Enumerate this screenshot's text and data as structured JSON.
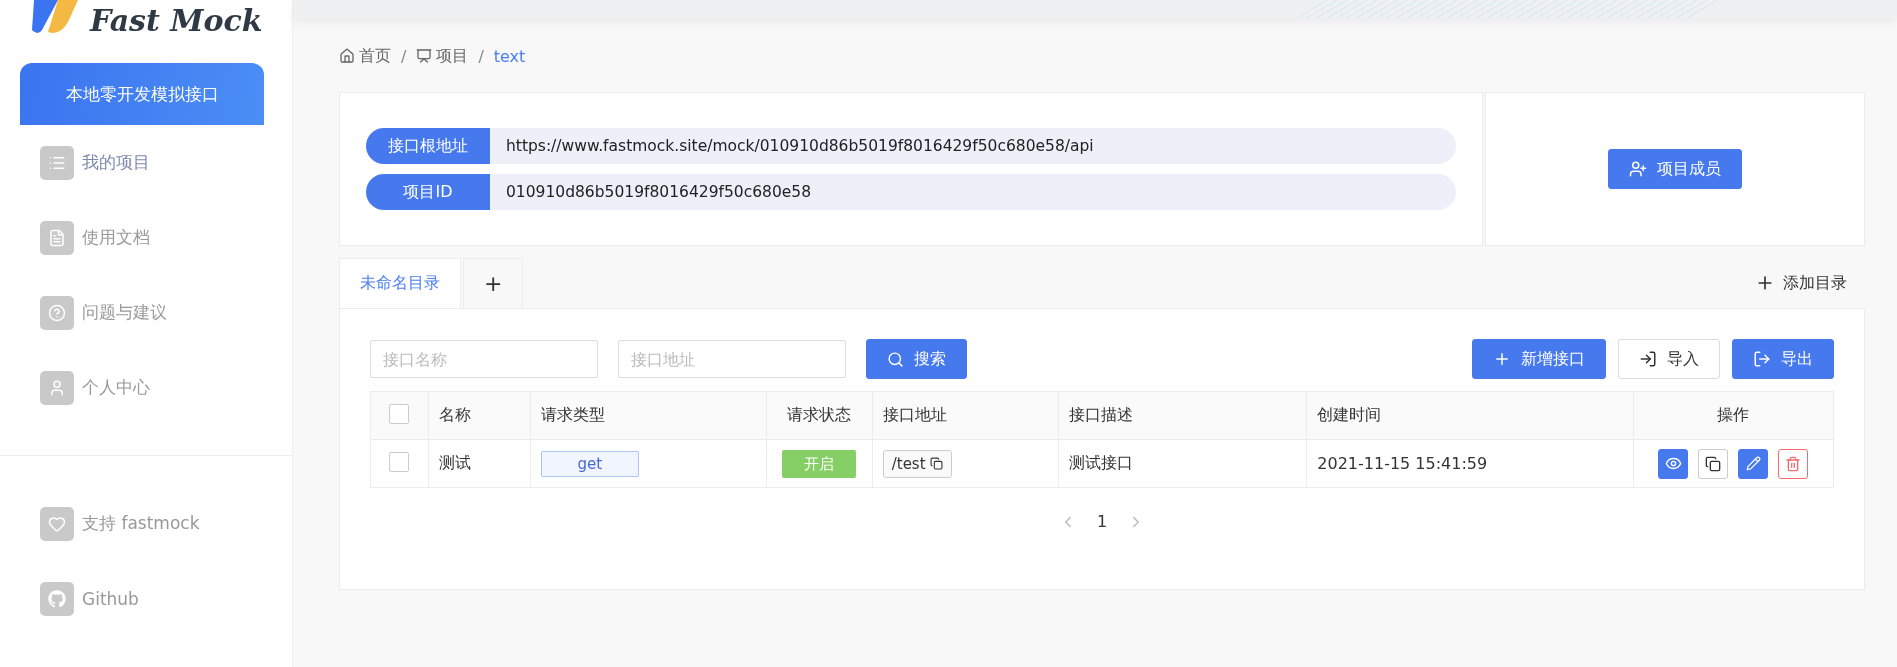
{
  "logo": {
    "text": "Fast Mock"
  },
  "sidebar": {
    "promo_button": "本地零开发模拟接口",
    "items": [
      {
        "label": "我的项目",
        "kind": "list",
        "selected": true
      },
      {
        "label": "使用文档",
        "kind": "doc",
        "selected": false
      },
      {
        "label": "问题与建议",
        "kind": "help",
        "selected": false
      },
      {
        "label": "个人中心",
        "kind": "user",
        "selected": false
      }
    ],
    "footer_items": [
      {
        "label": "支持 fastmock",
        "kind": "heart"
      },
      {
        "label": "Github",
        "kind": "github"
      }
    ]
  },
  "breadcrumb": {
    "separator": "/",
    "items": [
      {
        "label": "首页",
        "kind": "home"
      },
      {
        "label": "项目",
        "kind": "project"
      },
      {
        "label": "text",
        "kind": "current"
      }
    ]
  },
  "project_info": {
    "rows": [
      {
        "label": "接口根地址",
        "value": "https://www.fastmock.site/mock/010910d86b5019f8016429f50c680e58/api"
      },
      {
        "label": "项目ID",
        "value": "010910d86b5019f8016429f50c680e58"
      }
    ],
    "members_button": "项目成员"
  },
  "tabs": [
    {
      "label": "未命名目录",
      "selected": true
    },
    {
      "label": "+",
      "selected": false
    }
  ],
  "add_directory": "添加目录",
  "filters": [
    {
      "placeholder": "接口名称"
    },
    {
      "placeholder": "接口地址"
    }
  ],
  "search_button": "搜索",
  "actions": [
    {
      "label": "新增接口",
      "kind": "add",
      "primary": true
    },
    {
      "label": "导入",
      "kind": "import",
      "primary": false
    },
    {
      "label": "导出",
      "kind": "export",
      "primary": true
    }
  ],
  "table": {
    "header_checked": false,
    "columns": [
      "名称",
      "请求类型",
      "请求状态",
      "接口地址",
      "接口描述",
      "创建时间",
      "操作"
    ],
    "rows": [
      {
        "checked": false,
        "name": "测试",
        "method": "get",
        "status": "开启",
        "status_on": true,
        "path": "/test",
        "description": "测试接口",
        "created": "2021-11-15 15:41:59"
      }
    ]
  },
  "pagination": {
    "pages": [
      {
        "label": "1",
        "selected": true
      }
    ]
  }
}
